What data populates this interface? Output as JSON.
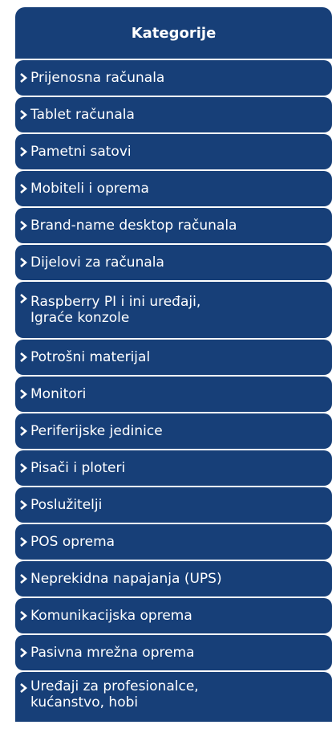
{
  "sidebar": {
    "title": "Kategorije",
    "items": [
      {
        "label": "Prijenosna računala"
      },
      {
        "label": "Tablet računala"
      },
      {
        "label": "Pametni satovi"
      },
      {
        "label": "Mobiteli i oprema"
      },
      {
        "label": "Brand-name desktop računala"
      },
      {
        "label": "Dijelovi za računala"
      },
      {
        "label": "Raspberry PI i ini uređaji,\nIgraće konzole"
      },
      {
        "label": "Potrošni materijal"
      },
      {
        "label": "Monitori"
      },
      {
        "label": "Periferijske jedinice"
      },
      {
        "label": "Pisači i ploteri"
      },
      {
        "label": "Poslužitelji"
      },
      {
        "label": "POS oprema"
      },
      {
        "label": "Neprekidna napajanja (UPS)"
      },
      {
        "label": "Komunikacijska oprema"
      },
      {
        "label": "Pasivna mrežna oprema"
      },
      {
        "label": "Uređaji za profesionalce,\nkućanstvo, hobi"
      }
    ],
    "icon": "chevron-right-icon",
    "colors": {
      "panel": "#173f78",
      "text": "#ffffff"
    }
  }
}
